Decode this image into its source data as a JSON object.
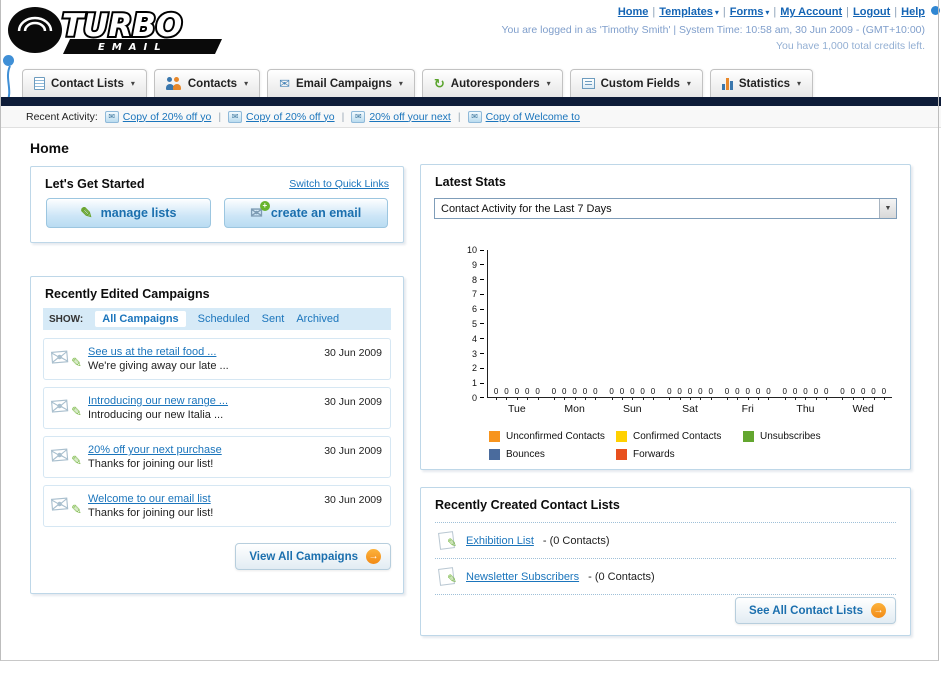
{
  "header": {
    "logo": {
      "title": "TURBO",
      "subtitle": "EMAIL"
    },
    "top_nav": [
      {
        "label": "Home",
        "has_dropdown": false
      },
      {
        "label": "Templates",
        "has_dropdown": true
      },
      {
        "label": "Forms",
        "has_dropdown": true
      },
      {
        "label": "My Account",
        "has_dropdown": false
      },
      {
        "label": "Logout",
        "has_dropdown": false
      },
      {
        "label": "Help",
        "has_dropdown": false
      }
    ],
    "login_info": "You are logged in as 'Timothy Smith' | System Time: 10:58 am, 30 Jun 2009 - (GMT+10:00)",
    "credits_info": "You have 1,000 total credits left."
  },
  "main_nav": {
    "tabs": [
      {
        "label": "Contact Lists"
      },
      {
        "label": "Contacts"
      },
      {
        "label": "Email Campaigns"
      },
      {
        "label": "Autoresponders"
      },
      {
        "label": "Custom Fields"
      },
      {
        "label": "Statistics"
      }
    ]
  },
  "recent_activity": {
    "label": "Recent Activity:",
    "items": [
      "Copy of 20% off yo",
      "Copy of 20% off yo",
      "20% off your next",
      "Copy of Welcome to"
    ]
  },
  "page_title": "Home",
  "get_started": {
    "title": "Let's Get Started",
    "switch_link": "Switch to Quick Links",
    "manage_lists_button": "manage lists",
    "create_email_button": "create an email"
  },
  "campaigns": {
    "title": "Recently Edited Campaigns",
    "show_label": "SHOW:",
    "filters": [
      "All Campaigns",
      "Scheduled",
      "Sent",
      "Archived"
    ],
    "items": [
      {
        "title": "See us at the retail food ...",
        "subtitle": "We're giving away our late ...",
        "date": "30 Jun 2009"
      },
      {
        "title": "Introducing our new range ...",
        "subtitle": "Introducing our new Italia ...",
        "date": "30 Jun 2009"
      },
      {
        "title": "20% off your next purchase",
        "subtitle": "Thanks for joining our list!",
        "date": "30 Jun 2009"
      },
      {
        "title": "Welcome to our email list",
        "subtitle": "Thanks for joining our list!",
        "date": "30 Jun 2009"
      }
    ],
    "view_all_button": "View All Campaigns"
  },
  "stats": {
    "title": "Latest Stats",
    "dropdown_value": "Contact Activity for the Last 7 Days"
  },
  "chart_data": {
    "type": "bar",
    "title": "Contact Activity for the Last 7 Days",
    "categories": [
      "Tue",
      "Mon",
      "Sun",
      "Sat",
      "Fri",
      "Thu",
      "Wed"
    ],
    "series": [
      {
        "name": "Unconfirmed Contacts",
        "color": "#f7941d",
        "values": [
          0,
          0,
          0,
          0,
          0,
          0,
          0
        ]
      },
      {
        "name": "Confirmed Contacts",
        "color": "#ffd100",
        "values": [
          0,
          0,
          0,
          0,
          0,
          0,
          0
        ]
      },
      {
        "name": "Unsubscribes",
        "color": "#63a62f",
        "values": [
          0,
          0,
          0,
          0,
          0,
          0,
          0
        ]
      },
      {
        "name": "Bounces",
        "color": "#4a6b9d",
        "values": [
          0,
          0,
          0,
          0,
          0,
          0,
          0
        ]
      },
      {
        "name": "Forwards",
        "color": "#e8501e",
        "values": [
          0,
          0,
          0,
          0,
          0,
          0,
          0
        ]
      }
    ],
    "ylim": [
      0,
      10
    ],
    "grid": false,
    "legend_position": "bottom"
  },
  "contact_lists": {
    "title": "Recently Created Contact Lists",
    "items": [
      {
        "name": "Exhibition List",
        "suffix": "- (0 Contacts)"
      },
      {
        "name": "Newsletter Subscribers",
        "suffix": "- (0 Contacts)"
      }
    ],
    "see_all_button": "See All Contact Lists"
  },
  "colors": {
    "accent_blue": "#1b75bc",
    "dark_bar": "#0e1c38",
    "panel_border": "#bed7e8",
    "orange_arrow": "#f28a16"
  },
  "icons": {
    "envelope": "✉",
    "pencil": "✎",
    "caret_down": "▾",
    "select_caret": "▼",
    "arrow_right": "→",
    "plus": "+",
    "refresh": "↻",
    "pipe": "|"
  }
}
